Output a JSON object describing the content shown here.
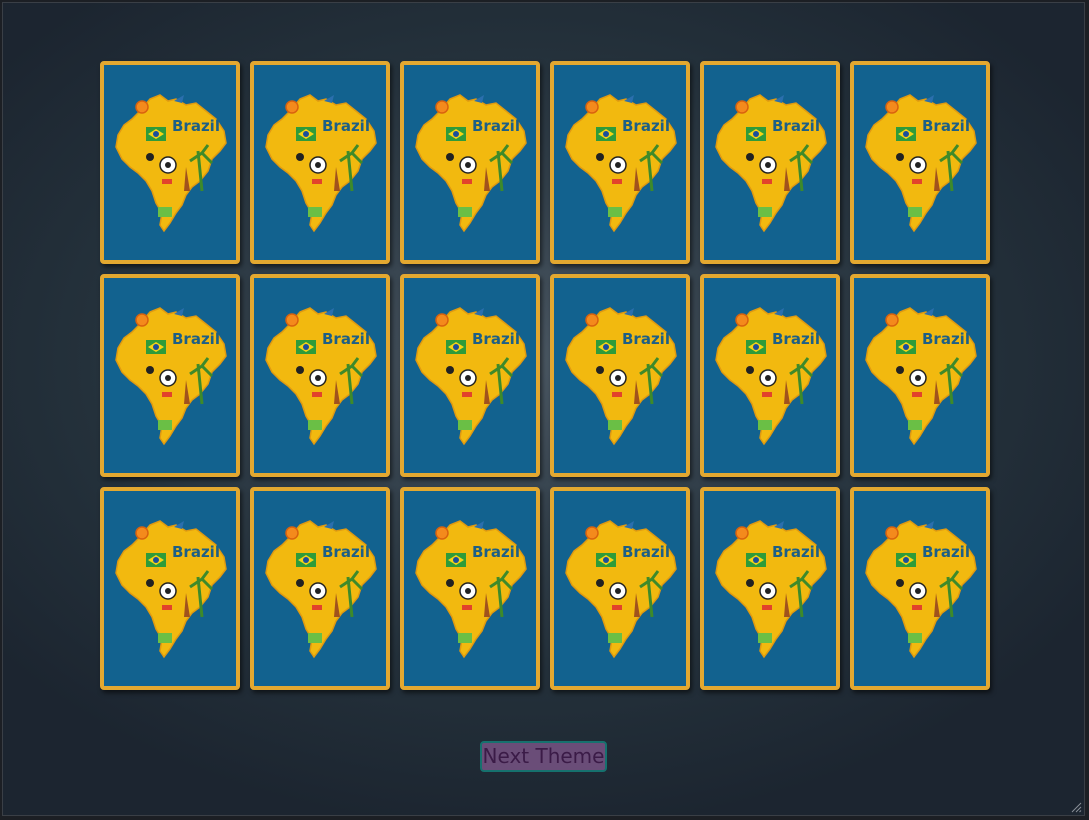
{
  "board": {
    "rows": 3,
    "columns": 6,
    "card_back": {
      "image": "brazil-map-illustration",
      "label": "Brazil",
      "colors": {
        "card_background": "#12628f",
        "card_border": "#e3a830",
        "map_fill": "#f2b90f"
      }
    },
    "cards": [
      {
        "face": "down",
        "label": "Brazil"
      },
      {
        "face": "down",
        "label": "Brazil"
      },
      {
        "face": "down",
        "label": "Brazil"
      },
      {
        "face": "down",
        "label": "Brazil"
      },
      {
        "face": "down",
        "label": "Brazil"
      },
      {
        "face": "down",
        "label": "Brazil"
      },
      {
        "face": "down",
        "label": "Brazil"
      },
      {
        "face": "down",
        "label": "Brazil"
      },
      {
        "face": "down",
        "label": "Brazil"
      },
      {
        "face": "down",
        "label": "Brazil"
      },
      {
        "face": "down",
        "label": "Brazil"
      },
      {
        "face": "down",
        "label": "Brazil"
      },
      {
        "face": "down",
        "label": "Brazil"
      },
      {
        "face": "down",
        "label": "Brazil"
      },
      {
        "face": "down",
        "label": "Brazil"
      },
      {
        "face": "down",
        "label": "Brazil"
      },
      {
        "face": "down",
        "label": "Brazil"
      },
      {
        "face": "down",
        "label": "Brazil"
      }
    ]
  },
  "controls": {
    "next_theme_label": "Next Theme",
    "next_theme_colors": {
      "background": "#6a4d78",
      "border": "#16716e",
      "text": "#3b1b47"
    }
  },
  "icons": {
    "resize": "resize-grip-icon"
  }
}
